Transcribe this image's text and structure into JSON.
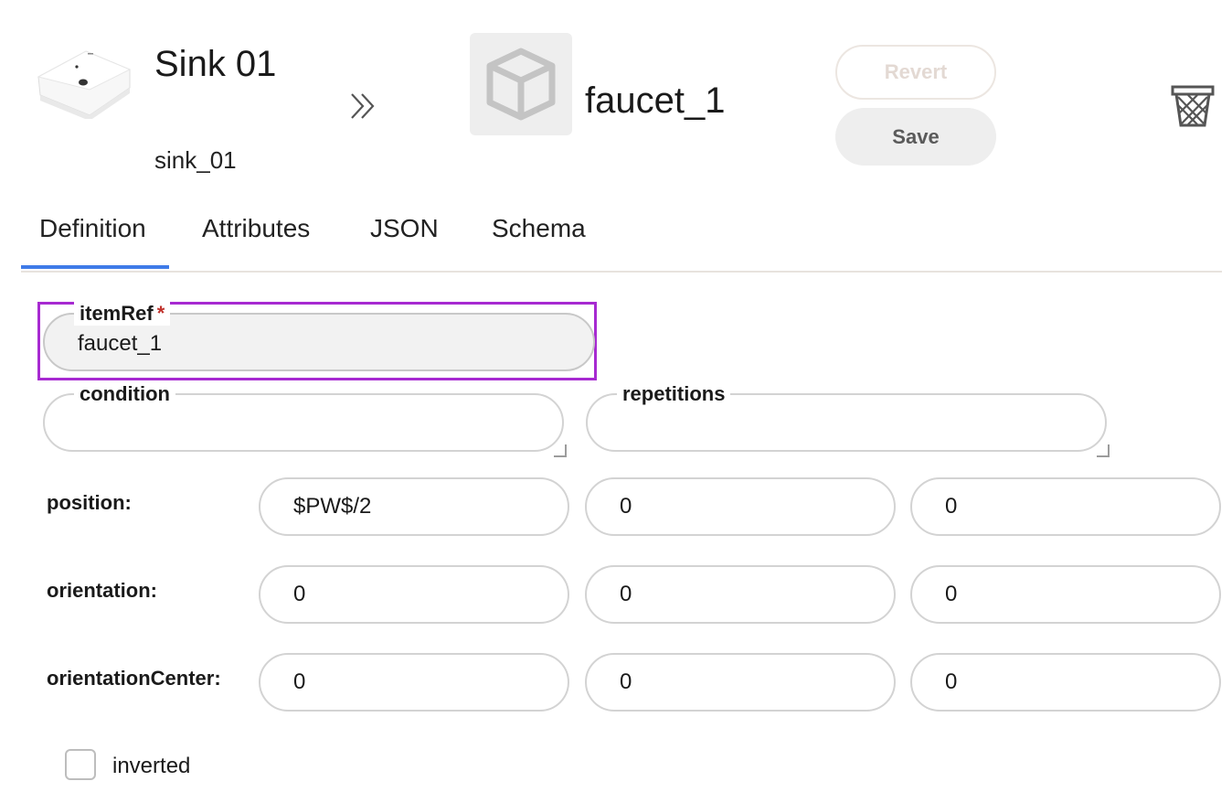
{
  "header": {
    "parent_name": "Sink 01",
    "parent_id": "sink_01",
    "child_name": "faucet_1",
    "revert_label": "Revert",
    "save_label": "Save"
  },
  "tabs": [
    {
      "label": "Definition",
      "active": true
    },
    {
      "label": "Attributes",
      "active": false
    },
    {
      "label": "JSON",
      "active": false
    },
    {
      "label": "Schema",
      "active": false
    }
  ],
  "form": {
    "itemRef": {
      "label": "itemRef",
      "required_mark": "*",
      "value": "faucet_1"
    },
    "condition": {
      "label": "condition",
      "value": ""
    },
    "repetitions": {
      "label": "repetitions",
      "value": ""
    },
    "position": {
      "label": "position:",
      "values": [
        "$PW$/2",
        "0",
        "0"
      ]
    },
    "orientation": {
      "label": "orientation:",
      "values": [
        "0",
        "0",
        "0"
      ]
    },
    "orientationCenter": {
      "label": "orientationCenter:",
      "values": [
        "0",
        "0",
        "0"
      ]
    },
    "inverted": {
      "label": "inverted",
      "checked": false
    }
  },
  "colors": {
    "accent": "#3f7be8",
    "highlight": "#a72ad1",
    "required": "#c0312b"
  },
  "icons": [
    "sink-thumbnail",
    "chevrons-right-icon",
    "cube-icon",
    "trash-icon"
  ]
}
